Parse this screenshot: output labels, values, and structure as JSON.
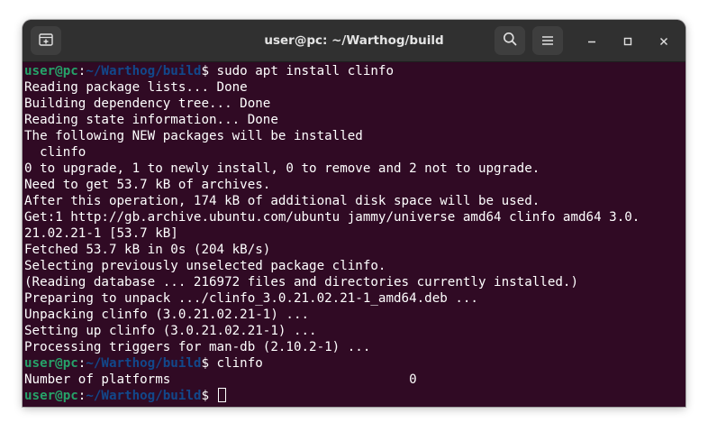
{
  "window": {
    "title": "user@pc: ~/Warthog/build"
  },
  "icons": {
    "new_tab": "new-tab-icon",
    "search": "search-icon",
    "menu": "hamburger-menu-icon",
    "minimize": "minimize-icon",
    "maximize": "maximize-icon",
    "close": "close-icon"
  },
  "colors": {
    "terminal_bg": "#300a24",
    "user_host": "#26a269",
    "path": "#12488b",
    "text": "#ffffff",
    "titlebar": "#303030"
  },
  "prompt": {
    "user_host": "user@pc",
    "sep": ":",
    "path": "~/Warthog/build",
    "symbol": "$"
  },
  "commands": {
    "c1": " sudo apt install clinfo",
    "c2": " clinfo",
    "c3": " "
  },
  "output": [
    "Reading package lists... Done",
    "Building dependency tree... Done",
    "Reading state information... Done",
    "The following NEW packages will be installed",
    "  clinfo",
    "0 to upgrade, 1 to newly install, 0 to remove and 2 not to upgrade.",
    "Need to get 53.7 kB of archives.",
    "After this operation, 174 kB of additional disk space will be used.",
    "Get:1 http://gb.archive.ubuntu.com/ubuntu jammy/universe amd64 clinfo amd64 3.0.",
    "21.02.21-1 [53.7 kB]",
    "Fetched 53.7 kB in 0s (204 kB/s)",
    "Selecting previously unselected package clinfo.",
    "(Reading database ... 216972 files and directories currently installed.)",
    "Preparing to unpack .../clinfo_3.0.21.02.21-1_amd64.deb ...",
    "Unpacking clinfo (3.0.21.02.21-1) ...",
    "Setting up clinfo (3.0.21.02.21-1) ...",
    "Processing triggers for man-db (2.10.2-1) ...",
    "Number of platforms                               0"
  ]
}
